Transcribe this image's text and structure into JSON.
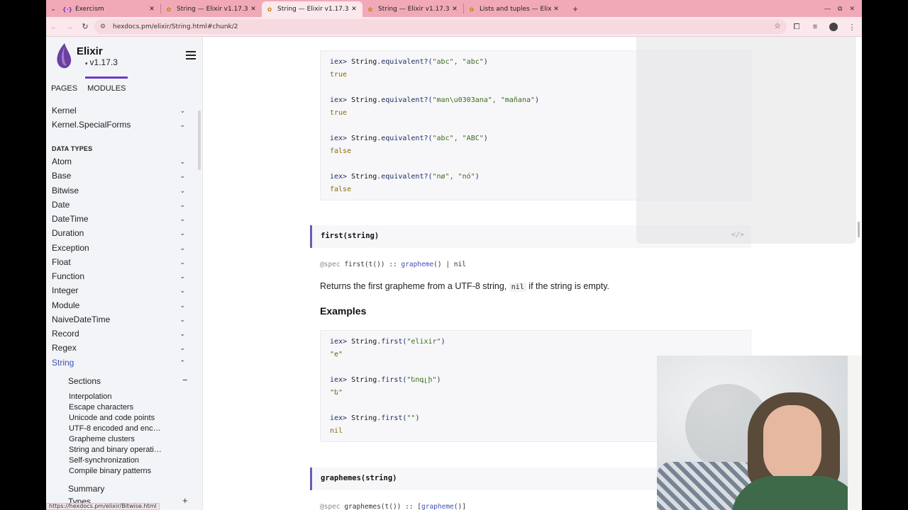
{
  "tabs": [
    {
      "title": "Exercism",
      "favicon": "exercism-icon",
      "active": false
    },
    {
      "title": "String — Elixir v1.17.3",
      "favicon": "hexdocs-icon",
      "active": false
    },
    {
      "title": "String — Elixir v1.17.3",
      "favicon": "hexdocs-icon",
      "active": true
    },
    {
      "title": "String — Elixir v1.17.3",
      "favicon": "hexdocs-icon",
      "active": false
    },
    {
      "title": "Lists and tuples — Elixir v",
      "favicon": "hexdocs-icon",
      "active": false
    }
  ],
  "toolbar": {
    "url": "hexdocs.pm/elixir/String.html#chunk/2"
  },
  "sidebar": {
    "brand": "Elixir",
    "version": "v1.17.3",
    "tabs": [
      "PAGES",
      "MODULES"
    ],
    "top_items": [
      "Kernel",
      "Kernel.SpecialForms"
    ],
    "heading": "DATA TYPES",
    "items": [
      "Atom",
      "Base",
      "Bitwise",
      "Date",
      "DateTime",
      "Duration",
      "Exception",
      "Float",
      "Function",
      "Integer",
      "Module",
      "NaiveDateTime",
      "Record",
      "Regex",
      "String"
    ],
    "sections_label": "Sections",
    "sections": [
      "Interpolation",
      "Escape characters",
      "Unicode and code points",
      "UTF-8 encoded and enc…",
      "Grapheme clusters",
      "String and binary operati…",
      "Self-synchronization",
      "Compile binary patterns"
    ],
    "summary_label": "Summary",
    "types_label": "Types"
  },
  "main": {
    "equivalent_block": [
      {
        "prompt": "iex> ",
        "mod": "String",
        "call": ".equivalent?(",
        "args": "\"abc\", \"abc\"",
        "close": ")",
        "result": "true"
      },
      {
        "prompt": "iex> ",
        "mod": "String",
        "call": ".equivalent?(",
        "args": "\"man\\u0303ana\", \"mañana\"",
        "close": ")",
        "result": "true"
      },
      {
        "prompt": "iex> ",
        "mod": "String",
        "call": ".equivalent?(",
        "args": "\"abc\", \"ABC\"",
        "close": ")",
        "result": "false"
      },
      {
        "prompt": "iex> ",
        "mod": "String",
        "call": ".equivalent?(",
        "args": "\"nø\", \"nó\"",
        "close": ")",
        "result": "false"
      }
    ],
    "first": {
      "title": "first(string)",
      "source_icon": "</>",
      "spec_at": "@spec",
      "spec_pre": " first(t()) :: ",
      "spec_link": "grapheme",
      "spec_post": "() | nil",
      "description_pre": "Returns the first grapheme from a UTF-8 string, ",
      "description_code": "nil",
      "description_post": " if the string is empty.",
      "examples_heading": "Examples",
      "examples": [
        {
          "prompt": "iex> ",
          "mod": "String",
          "call": ".first(",
          "args": "\"elixir\"",
          "close": ")",
          "result": "\"e\""
        },
        {
          "prompt": "iex> ",
          "mod": "String",
          "call": ".first(",
          "args": "\"եոգլի\"",
          "close": ")",
          "result": "\"ե\""
        },
        {
          "prompt": "iex> ",
          "mod": "String",
          "call": ".first(",
          "args": "\"\"",
          "close": ")",
          "result": "nil"
        }
      ]
    },
    "graphemes": {
      "title": "graphemes(string)",
      "spec_at": "@spec",
      "spec_pre": " graphemes(t()) :: [",
      "spec_link": "grapheme",
      "spec_post": "()]"
    }
  },
  "status_url": "https://hexdocs.pm/elixir/Bitwise.html"
}
